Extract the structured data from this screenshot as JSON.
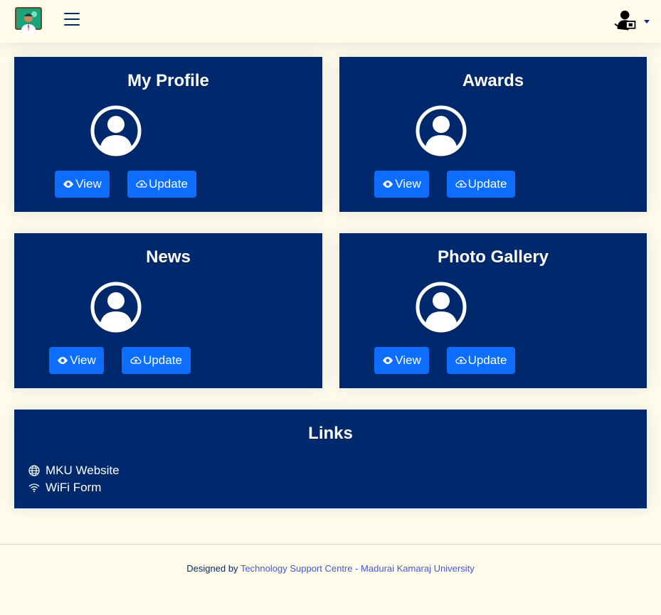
{
  "header": {
    "logo_icon": "teacher-avatar-logo",
    "menu_icon": "hamburger-icon",
    "user_icon": "user-teacher-icon"
  },
  "cards": [
    {
      "title": "My Profile",
      "view_label": "View",
      "update_label": "Update"
    },
    {
      "title": "Awards",
      "view_label": "View",
      "update_label": "Update"
    },
    {
      "title": "News",
      "view_label": "View",
      "update_label": "Update"
    },
    {
      "title": "Photo Gallery",
      "view_label": "View",
      "update_label": "Update"
    }
  ],
  "links": {
    "title": "Links",
    "items": [
      {
        "label": "MKU Website",
        "icon": "globe-icon"
      },
      {
        "label": "WiFi Form",
        "icon": "wifi-icon"
      }
    ]
  },
  "footer": {
    "prefix": "Designed by",
    "link_text": "Technology Support Centre - Madurai Kamaraj University"
  },
  "colors": {
    "background": "#fefbea",
    "card": "#00296d",
    "button": "#0d6efd",
    "link": "#4154f1"
  }
}
